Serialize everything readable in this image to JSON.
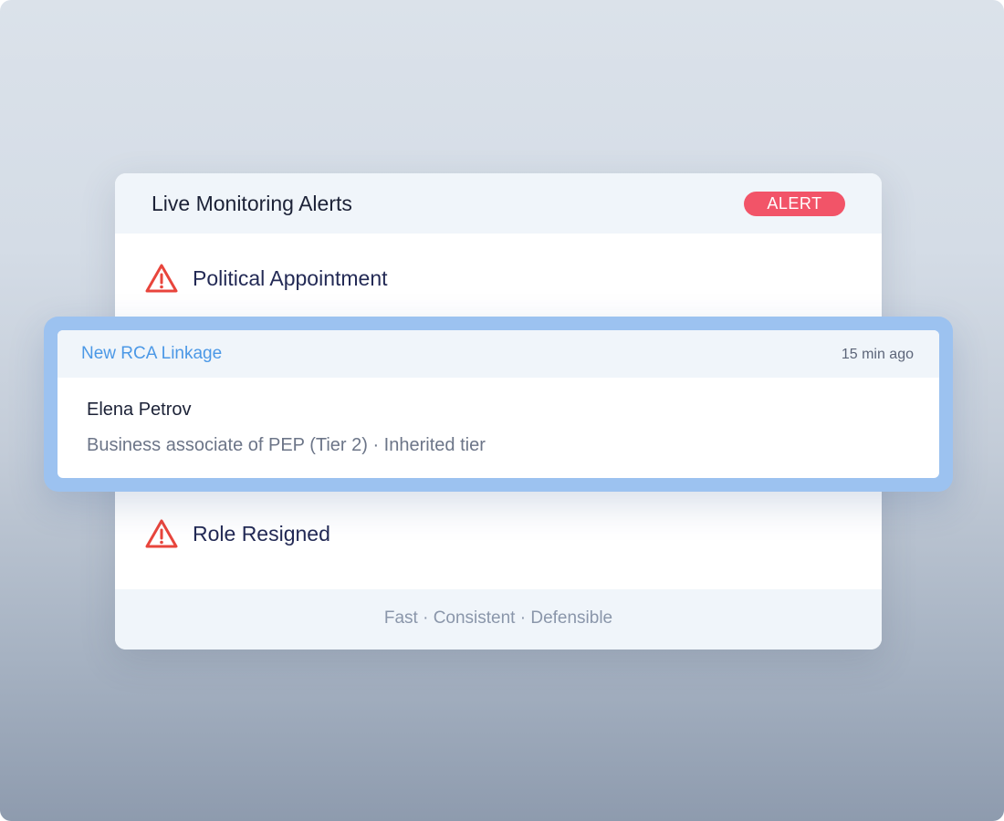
{
  "panel": {
    "title": "Live Monitoring Alerts",
    "badge": "ALERT",
    "badge_color": "#f25468"
  },
  "alerts": [
    {
      "icon": "warning-triangle-icon",
      "label": "Political Appointment",
      "icon_color": "#e8453c"
    },
    {
      "icon": "warning-triangle-icon",
      "label": "Role Resigned",
      "icon_color": "#e8453c"
    }
  ],
  "highlight": {
    "title": "New RCA Linkage",
    "time": "15 min ago",
    "name": "Elena Petrov",
    "description": "Business associate of PEP (Tier 2) · Inherited tier",
    "accent_color": "#4b98e6"
  },
  "footer": {
    "tagline": "Fast · Consistent · Defensible"
  }
}
